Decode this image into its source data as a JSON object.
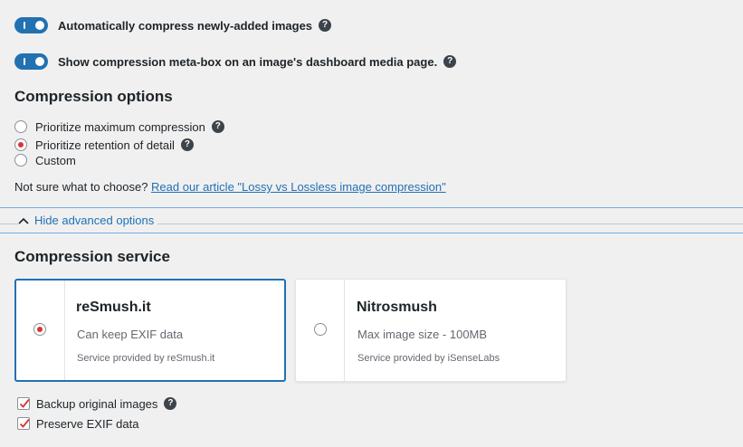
{
  "toggles": [
    {
      "label": "Automatically compress newly-added images",
      "on": true
    },
    {
      "label": "Show compression meta-box on an image's dashboard media page.",
      "on": true
    }
  ],
  "compression_options": {
    "heading": "Compression options",
    "options": [
      {
        "label": "Prioritize maximum compression",
        "checked": false,
        "help": true
      },
      {
        "label": "Prioritize retention of detail",
        "checked": true,
        "help": true
      },
      {
        "label": "Custom",
        "checked": false,
        "help": false
      }
    ],
    "hint_text": "Not sure what to choose? ",
    "hint_link": "Read our article \"Lossy vs Lossless image compression\""
  },
  "advanced": {
    "label": "Hide advanced options"
  },
  "compression_service": {
    "heading": "Compression service",
    "services": [
      {
        "name": "reSmush.it",
        "description": "Can keep EXIF data",
        "provider": "Service provided by reSmush.it",
        "selected": true
      },
      {
        "name": "Nitrosmush",
        "description": "Max image size - 100MB",
        "provider": "Service provided by iSenseLabs",
        "selected": false
      }
    ]
  },
  "checkboxes": [
    {
      "label": "Backup original images",
      "checked": true,
      "help": true
    },
    {
      "label": "Preserve EXIF data",
      "checked": true,
      "help": false
    }
  ],
  "help_glyph": "?",
  "colors": {
    "accent": "#2271b1",
    "radio_dot": "#d63638",
    "background": "#f0f0f1"
  }
}
